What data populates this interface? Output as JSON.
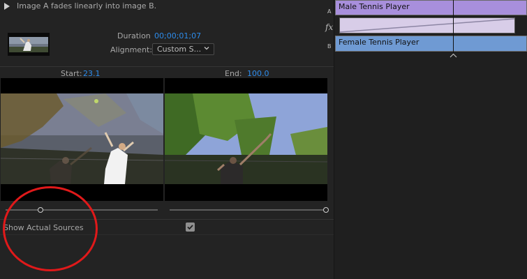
{
  "header": {
    "description": "Image A fades linearly into image B."
  },
  "properties": {
    "duration_label": "Duration",
    "duration_value": "00;00;01;07",
    "alignment_label": "Alignment:",
    "alignment_value": "Custom S..."
  },
  "preview": {
    "start_label": "Start:",
    "start_value": "23.1",
    "end_label": "End:",
    "end_value": "100.0",
    "start_slider_percent": 23.1,
    "end_slider_percent": 100.0
  },
  "options": {
    "show_actual_sources_label": "Show Actual Sources",
    "show_actual_sources_checked": true
  },
  "timeline": {
    "track_a_label": "A",
    "track_b_label": "B",
    "fx_label": "fx",
    "clip_a_name": "Male Tennis Player",
    "clip_b_name": "Female Tennis Player",
    "clip_a_color": "#a88fdc",
    "clip_b_color": "#6f9ad3",
    "transition_color": "#d8cde8"
  },
  "annotation": {
    "circle_color": "#e0191a"
  },
  "icons": {
    "play": "play-icon",
    "dropdown": "chevron-down-icon",
    "check": "checkmark-icon",
    "playhead": "playhead-icon"
  }
}
